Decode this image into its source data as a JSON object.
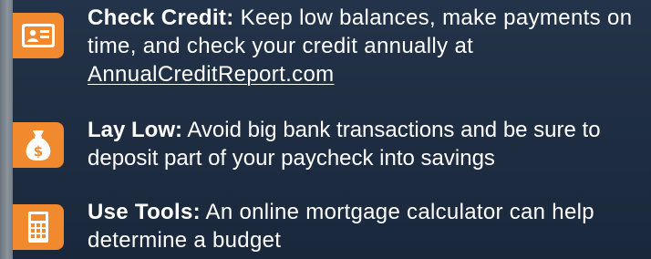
{
  "colors": {
    "background": "#1f2e44",
    "accent": "#f18a2e",
    "text": "#ffffff"
  },
  "tips": [
    {
      "icon": "credit-card-icon",
      "title": "Check Credit:",
      "body": " Keep low balances, make payments on time, and check your credit annually at ",
      "link": "AnnualCreditReport.com"
    },
    {
      "icon": "money-bag-icon",
      "title": "Lay Low:",
      "body": " Avoid big bank transactions and be sure to deposit part of your paycheck into savings"
    },
    {
      "icon": "calculator-icon",
      "title": "Use Tools:",
      "body": " An online mortgage calculator can help determine a budget"
    }
  ]
}
